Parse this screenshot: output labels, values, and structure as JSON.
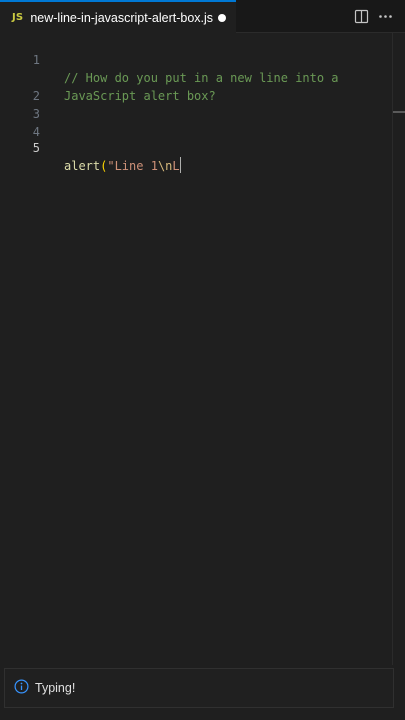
{
  "tab": {
    "language_badge": "JS",
    "file_name": "new-line-in-javascript-alert-box.js",
    "dirty_indicator": "dot-icon",
    "actions": [
      "split-editor-icon",
      "more-actions-icon"
    ]
  },
  "editor": {
    "lines": [
      {
        "number": "1",
        "comment": "// How do you put in a new line into a"
      },
      {
        "number": "",
        "comment": "JavaScript alert box?"
      },
      {
        "number": "2"
      },
      {
        "number": "3"
      },
      {
        "number": "4"
      },
      {
        "number": "5",
        "fn": "alert",
        "paren": "(",
        "str_open": "\"Line 1",
        "escape": "\\n",
        "str_rest": "L"
      }
    ],
    "active_line": "5"
  },
  "notification": {
    "icon": "info-icon",
    "message": "Typing!"
  },
  "colors": {
    "accent": "#0078d4",
    "js_badge": "#cbcb41",
    "comment": "#6a9955",
    "function": "#dcdcaa",
    "string": "#ce9178",
    "escape": "#d7ba7d",
    "bracket": "#ffd700"
  }
}
